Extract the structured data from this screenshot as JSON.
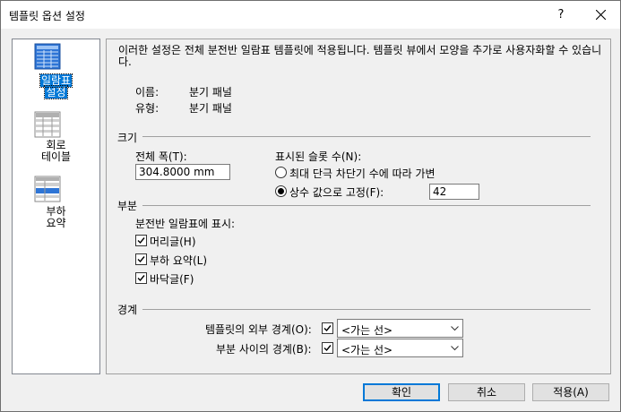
{
  "window": {
    "title": "템플릿 옵션 설정",
    "help_label": "?"
  },
  "nav": {
    "items": [
      {
        "label_line1": "일람표",
        "label_line2": "설정",
        "icon": "panel-schedule-icon",
        "selected": true
      },
      {
        "label_line1": "회로",
        "label_line2": "테이블",
        "icon": "circuit-table-icon",
        "selected": false
      },
      {
        "label_line1": "부하",
        "label_line2": "요약",
        "icon": "load-summary-icon",
        "selected": false
      }
    ]
  },
  "content": {
    "description": "이러한 설정은 전체 분전반 일람표 템플릿에 적용됩니다. 템플릿 뷰에서 모양을 추가로 사용자화할 수 있습니다.",
    "name_label": "이름:",
    "name_value": "분기 패널",
    "type_label": "유형:",
    "type_value": "분기 패널",
    "size_group": "크기",
    "total_width_label": "전체 폭(T):",
    "total_width_value": "304.8000 mm",
    "slots_label": "표시된 슬롯 수(N):",
    "radio_variable_label": "최대 단극 차단기 수에 따라 가변",
    "radio_fixed_label": "상수 값으로 고정(F):",
    "fixed_value": "42",
    "section_group": "부분",
    "show_label": "분전반 일람표에 표시:",
    "check_header_label": "머리글(H)",
    "check_load_summary_label": "부하 요약(L)",
    "check_footer_label": "바닥글(F)",
    "border_group": "경계",
    "outer_border_label": "템플릿의 외부 경계(O):",
    "outer_border_value": "<가는 선>",
    "section_border_label": "부분 사이의 경계(B):",
    "section_border_value": "<가는 선>"
  },
  "buttons": {
    "ok": "확인",
    "cancel": "취소",
    "apply": "적용(A)"
  },
  "colors": {
    "accent": "#0078d7",
    "icon_blue": "#2e75d6"
  }
}
